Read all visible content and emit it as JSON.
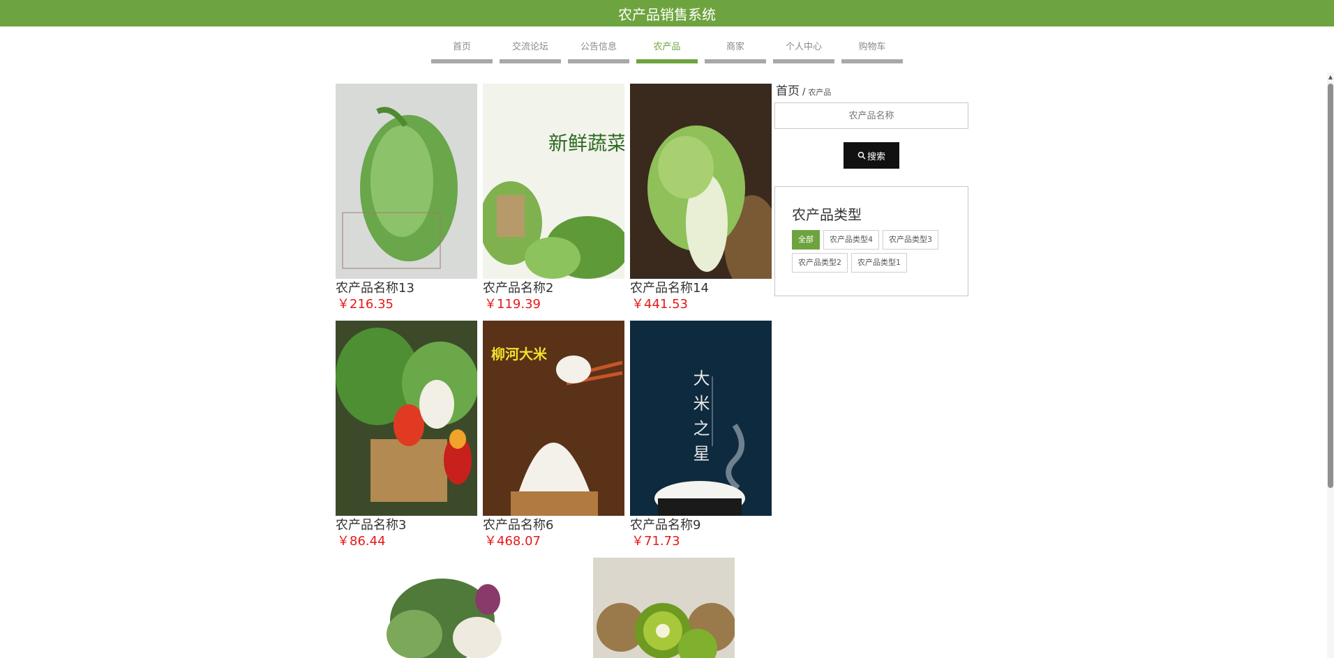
{
  "header": {
    "title": "农产品销售系统"
  },
  "nav": [
    {
      "label": "首页",
      "active": false
    },
    {
      "label": "交流论坛",
      "active": false
    },
    {
      "label": "公告信息",
      "active": false
    },
    {
      "label": "农产品",
      "active": true
    },
    {
      "label": "商家",
      "active": false
    },
    {
      "label": "个人中心",
      "active": false
    },
    {
      "label": "购物车",
      "active": false
    }
  ],
  "products": [
    {
      "name": "农产品名称13",
      "price": "￥216.35"
    },
    {
      "name": "农产品名称2",
      "price": "￥119.39"
    },
    {
      "name": "农产品名称14",
      "price": "￥441.53"
    },
    {
      "name": "农产品名称3",
      "price": "￥86.44"
    },
    {
      "name": "农产品名称6",
      "price": "￥468.07"
    },
    {
      "name": "农产品名称9",
      "price": "￥71.73"
    },
    {
      "name": "",
      "price": ""
    },
    {
      "name": "",
      "price": ""
    }
  ],
  "image_text": {
    "p2": "新鲜蔬菜",
    "p5": "柳河大米",
    "p6": "大米之星"
  },
  "breadcrumb": {
    "home": "首页",
    "separator": "/",
    "current": "农产品"
  },
  "search": {
    "placeholder": "农产品名称",
    "button_label": "搜索",
    "button_icon": "search-icon"
  },
  "types": {
    "title": "农产品类型",
    "items": [
      {
        "label": "全部",
        "active": true
      },
      {
        "label": "农产品类型4",
        "active": false
      },
      {
        "label": "农产品类型3",
        "active": false
      },
      {
        "label": "农产品类型2",
        "active": false
      },
      {
        "label": "农产品类型1",
        "active": false
      }
    ]
  },
  "colors": {
    "brand": "#6ea43f",
    "price": "#e81818",
    "button": "#111111"
  }
}
